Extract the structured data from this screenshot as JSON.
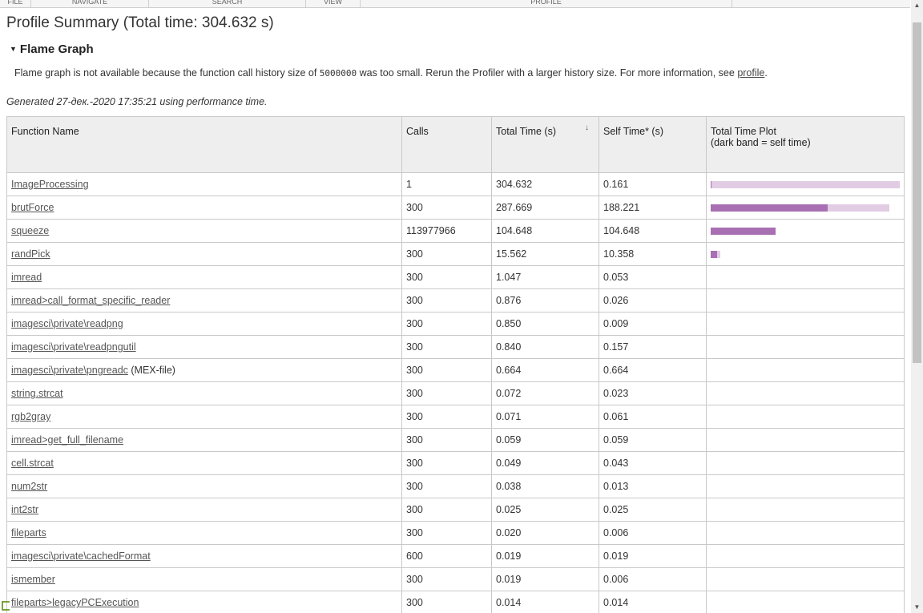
{
  "toolstrip": {
    "sections": [
      "FILE",
      "NAVIGATE",
      "SEARCH",
      "VIEW",
      "PROFILE"
    ]
  },
  "page": {
    "title": "Profile Summary (Total time: 304.632 s)",
    "flame_graph": {
      "header": "Flame Graph",
      "msg_before": "Flame graph is not available because the function call history size of ",
      "history_size": "5000000",
      "msg_after": " was too small. Rerun the Profiler with a larger history size. For more information, see ",
      "link_text": "profile",
      "msg_end": "."
    },
    "generated": "Generated 27-дек.-2020 17:35:21 using performance time."
  },
  "table": {
    "headers": {
      "function_name": "Function Name",
      "calls": "Calls",
      "total_time": "Total Time (s)",
      "self_time": "Self Time* (s)",
      "plot_line1": "Total Time Plot",
      "plot_line2": "(dark band = self time)"
    },
    "sort_indicator": "↓",
    "rows": [
      {
        "name": "ImageProcessing",
        "suffix": "",
        "calls": "1",
        "total": "304.632",
        "self": "0.161",
        "total_frac": 1.0,
        "self_frac": 0.0005
      },
      {
        "name": "brutForce",
        "suffix": "",
        "calls": "300",
        "total": "287.669",
        "self": "188.221",
        "total_frac": 0.944,
        "self_frac": 0.618
      },
      {
        "name": "squeeze",
        "suffix": "",
        "calls": "113977966",
        "total": "104.648",
        "self": "104.648",
        "total_frac": 0.3435,
        "self_frac": 0.3435
      },
      {
        "name": "randPick",
        "suffix": "",
        "calls": "300",
        "total": "15.562",
        "self": "10.358",
        "total_frac": 0.051,
        "self_frac": 0.034
      },
      {
        "name": "imread",
        "suffix": "",
        "calls": "300",
        "total": "1.047",
        "self": "0.053",
        "total_frac": 0,
        "self_frac": 0
      },
      {
        "name": "imread>call_format_specific_reader",
        "suffix": "",
        "calls": "300",
        "total": "0.876",
        "self": "0.026",
        "total_frac": 0,
        "self_frac": 0
      },
      {
        "name": "imagesci\\private\\readpng",
        "suffix": "",
        "calls": "300",
        "total": "0.850",
        "self": "0.009",
        "total_frac": 0,
        "self_frac": 0
      },
      {
        "name": "imagesci\\private\\readpngutil",
        "suffix": "",
        "calls": "300",
        "total": "0.840",
        "self": "0.157",
        "total_frac": 0,
        "self_frac": 0
      },
      {
        "name": "imagesci\\private\\pngreadc",
        "suffix": " (MEX-file)",
        "calls": "300",
        "total": "0.664",
        "self": "0.664",
        "total_frac": 0,
        "self_frac": 0
      },
      {
        "name": "string.strcat",
        "suffix": "",
        "calls": "300",
        "total": "0.072",
        "self": "0.023",
        "total_frac": 0,
        "self_frac": 0
      },
      {
        "name": "rgb2gray",
        "suffix": "",
        "calls": "300",
        "total": "0.071",
        "self": "0.061",
        "total_frac": 0,
        "self_frac": 0
      },
      {
        "name": "imread>get_full_filename",
        "suffix": "",
        "calls": "300",
        "total": "0.059",
        "self": "0.059",
        "total_frac": 0,
        "self_frac": 0
      },
      {
        "name": "cell.strcat",
        "suffix": "",
        "calls": "300",
        "total": "0.049",
        "self": "0.043",
        "total_frac": 0,
        "self_frac": 0
      },
      {
        "name": "num2str",
        "suffix": "",
        "calls": "300",
        "total": "0.038",
        "self": "0.013",
        "total_frac": 0,
        "self_frac": 0
      },
      {
        "name": "int2str",
        "suffix": "",
        "calls": "300",
        "total": "0.025",
        "self": "0.025",
        "total_frac": 0,
        "self_frac": 0
      },
      {
        "name": "fileparts",
        "suffix": "",
        "calls": "300",
        "total": "0.020",
        "self": "0.006",
        "total_frac": 0,
        "self_frac": 0
      },
      {
        "name": "imagesci\\private\\cachedFormat",
        "suffix": "",
        "calls": "600",
        "total": "0.019",
        "self": "0.019",
        "total_frac": 0,
        "self_frac": 0
      },
      {
        "name": "ismember",
        "suffix": "",
        "calls": "300",
        "total": "0.019",
        "self": "0.006",
        "total_frac": 0,
        "self_frac": 0
      },
      {
        "name": "fileparts>legacyPCExecution",
        "suffix": "",
        "calls": "300",
        "total": "0.014",
        "self": "0.014",
        "total_frac": 0,
        "self_frac": 0
      }
    ]
  },
  "colors": {
    "total_bar": "#e2cce4",
    "self_bar": "#a86fb2"
  }
}
